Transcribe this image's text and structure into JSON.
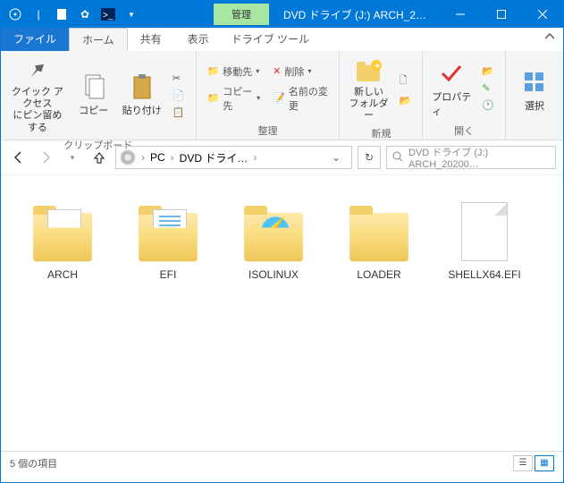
{
  "titlebar": {
    "manage_label": "管理",
    "title": "DVD ドライブ (J:) ARCH_2…"
  },
  "tabs": {
    "file": "ファイル",
    "home": "ホーム",
    "share": "共有",
    "view": "表示",
    "drive_tools": "ドライブ ツール"
  },
  "ribbon": {
    "pin_access": "クイック アクセス\nにピン留めする",
    "copy": "コピー",
    "paste": "貼り付け",
    "clipboard_label": "クリップボード",
    "move_to": "移動先",
    "copy_to": "コピー先",
    "delete": "削除",
    "rename": "名前の変更",
    "organize_label": "整理",
    "new_folder": "新しい\nフォルダー",
    "new_label": "新規",
    "properties": "プロパティ",
    "open_label": "開く",
    "select": "選択"
  },
  "breadcrumb": {
    "pc": "PC",
    "drive": "DVD ドライ…"
  },
  "search": {
    "placeholder": "DVD ドライブ (J:) ARCH_20200…"
  },
  "items": [
    {
      "name": "ARCH",
      "type": "folder-doc"
    },
    {
      "name": "EFI",
      "type": "folder-lines"
    },
    {
      "name": "ISOLINUX",
      "type": "folder-bolt"
    },
    {
      "name": "LOADER",
      "type": "folder"
    },
    {
      "name": "SHELLX64.EFI",
      "type": "file"
    }
  ],
  "status": {
    "count": "5 個の項目"
  }
}
